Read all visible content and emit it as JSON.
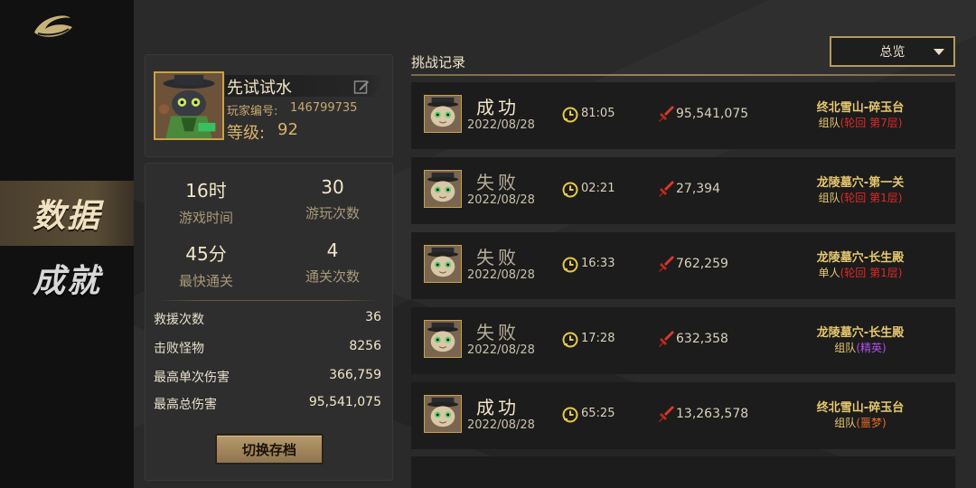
{
  "nav": {
    "items": [
      {
        "label": "数据",
        "active": true
      },
      {
        "label": "成就",
        "active": false
      }
    ]
  },
  "profile": {
    "name": "先试试水",
    "id_label": "玩家编号:",
    "id": "146799735",
    "level_label": "等级:",
    "level": "92"
  },
  "stats": {
    "big": [
      {
        "value": "16时",
        "label": "游戏时间"
      },
      {
        "value": "30",
        "label": "游玩次数"
      },
      {
        "value": "45分",
        "label": "最快通关"
      },
      {
        "value": "4",
        "label": "通关次数"
      }
    ],
    "rows": [
      {
        "label": "救援次数",
        "value": "36"
      },
      {
        "label": "击败怪物",
        "value": "8256"
      },
      {
        "label": "最高单次伤害",
        "value": "366,759"
      },
      {
        "label": "最高总伤害",
        "value": "95,541,075"
      }
    ],
    "switch_button": "切换存档"
  },
  "records": {
    "title": "挑战记录",
    "filter": "总览",
    "items": [
      {
        "result": "成功",
        "win": true,
        "date": "2022/08/28",
        "time": "81:05",
        "damage": "95,541,075",
        "stage": "终北雪山-碎玉台",
        "mode_prefix": "组队",
        "mode_detail": "(轮回 第7层)",
        "mode_color": "red"
      },
      {
        "result": "失败",
        "win": false,
        "date": "2022/08/28",
        "time": "02:21",
        "damage": "27,394",
        "stage": "龙陵墓穴-第一关",
        "mode_prefix": "组队",
        "mode_detail": "(轮回 第1层)",
        "mode_color": "red"
      },
      {
        "result": "失败",
        "win": false,
        "date": "2022/08/28",
        "time": "16:33",
        "damage": "762,259",
        "stage": "龙陵墓穴-长生殿",
        "mode_prefix": "单人",
        "mode_detail": "(轮回 第1层)",
        "mode_color": "red"
      },
      {
        "result": "失败",
        "win": false,
        "date": "2022/08/28",
        "time": "17:28",
        "damage": "632,358",
        "stage": "龙陵墓穴-长生殿",
        "mode_prefix": "组队",
        "mode_detail": "(精英)",
        "mode_color": "purple"
      },
      {
        "result": "成功",
        "win": true,
        "date": "2022/08/28",
        "time": "65:25",
        "damage": "13,263,578",
        "stage": "终北雪山-碎玉台",
        "mode_prefix": "组队",
        "mode_detail": "(噩梦)",
        "mode_color": "orange"
      }
    ]
  },
  "colors": {
    "accent_gold": "#c9a24a",
    "win_text": "#f2e6c8",
    "stage_yellow": "#e6c870"
  }
}
